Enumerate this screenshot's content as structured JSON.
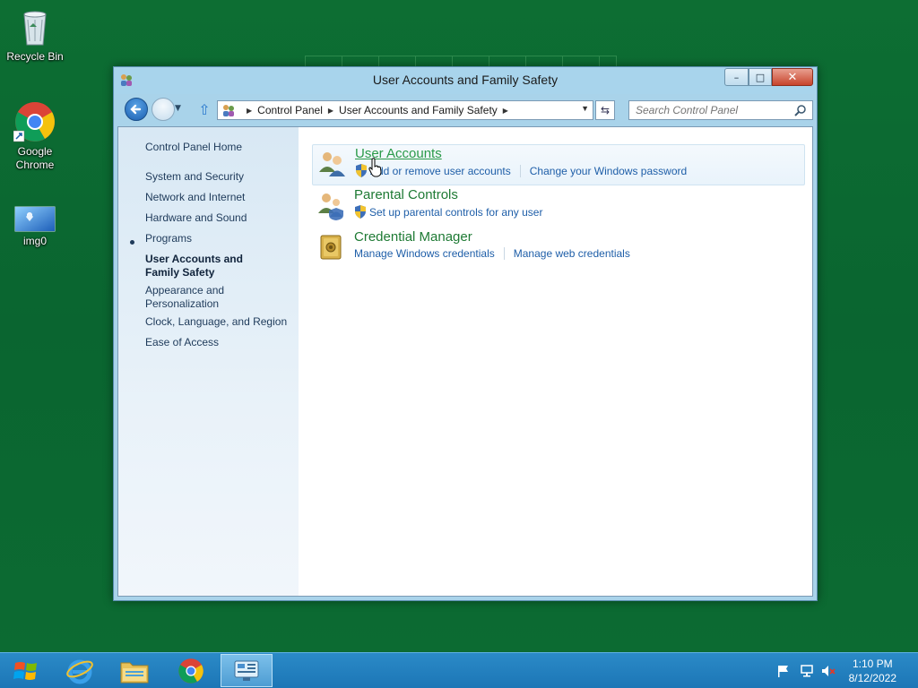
{
  "desktop": {
    "icons": [
      {
        "label": "Recycle Bin"
      },
      {
        "label": "Google Chrome"
      },
      {
        "label": "img0"
      }
    ]
  },
  "window": {
    "title": "User Accounts and Family Safety",
    "controls": {
      "minimize": "–",
      "maximize": "□",
      "close": "✕"
    },
    "address": {
      "crumbs": [
        "Control Panel",
        "User Accounts and Family Safety"
      ]
    },
    "search": {
      "placeholder": "Search Control Panel"
    }
  },
  "left_nav": {
    "home": "Control Panel Home",
    "items": [
      "System and Security",
      "Network and Internet",
      "Hardware and Sound",
      "Programs",
      "User Accounts and Family Safety",
      "Appearance and Personalization",
      "Clock, Language, and Region",
      "Ease of Access"
    ],
    "active_index": 4
  },
  "categories": [
    {
      "title": "User Accounts",
      "links": [
        "Add or remove user accounts",
        "Change your Windows password"
      ]
    },
    {
      "title": "Parental Controls",
      "links": [
        "Set up parental controls for any user"
      ]
    },
    {
      "title": "Credential Manager",
      "links": [
        "Manage Windows credentials",
        "Manage web credentials"
      ]
    }
  ],
  "taskbar": {
    "clock": {
      "time": "1:10 PM",
      "date": "8/12/2022"
    }
  },
  "colors": {
    "desktop": "#0b6b2e",
    "window_frame": "#a9d3ea",
    "taskbar": "#1c76b6",
    "category_title": "#1e7a34",
    "link": "#1e5ea8"
  }
}
